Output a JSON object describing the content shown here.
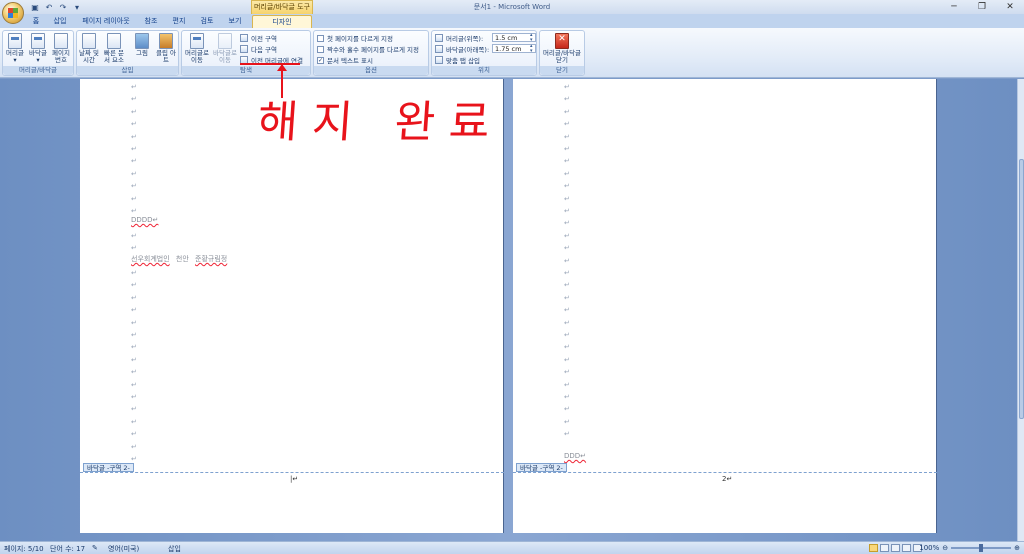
{
  "window": {
    "title": "문서1 - Microsoft Word",
    "context_tools": "머리글/바닥글 도구"
  },
  "qat": {
    "save_icon": "save-icon",
    "undo_icon": "undo-icon",
    "redo_icon": "redo-icon"
  },
  "tabs": [
    {
      "label": "홈"
    },
    {
      "label": "삽입"
    },
    {
      "label": "페이지 레이아웃"
    },
    {
      "label": "참조"
    },
    {
      "label": "편지"
    },
    {
      "label": "검토"
    },
    {
      "label": "보기"
    },
    {
      "label": "디자인"
    }
  ],
  "ribbon": {
    "header_footer": {
      "label": "머리글/바닥글",
      "header": "머리글",
      "footer": "바닥글",
      "page_number": "페이지 번호"
    },
    "insert": {
      "label": "삽입",
      "date_time": "날짜 및 시간",
      "quick_parts": "빠른 문서 요소",
      "picture": "그림",
      "clip_art": "클립 아트"
    },
    "navigation": {
      "label": "탐색",
      "goto_header": "머리글로 이동",
      "goto_footer": "바닥글로 이동",
      "prev_section": "이전 구역",
      "next_section": "다음 구역",
      "link_previous": "이전 머리글에 연결"
    },
    "options": {
      "label": "옵션",
      "different_first": "첫 페이지를 다르게 지정",
      "different_odd_even": "짝수와 홀수 페이지를 다르게 지정",
      "show_doc_text": "문서 텍스트 표시"
    },
    "position": {
      "label": "위치",
      "header_top_label": "머리글(위쪽):",
      "header_top_value": "1.5 cm",
      "footer_bottom_label": "바닥글(아래쪽):",
      "footer_bottom_value": "1.75 cm",
      "insert_align_tab": "맞춤 탭 삽입"
    },
    "close": {
      "label": "닫기",
      "close_button": "머리글/바닥글 닫기"
    }
  },
  "document": {
    "page1": {
      "line_dddd": "DDDD",
      "line_korean_1": "선우회계법인",
      "line_korean_2": "천안",
      "line_korean_3": "준황규림정",
      "footer_tag": "바닥글 -구역 2-"
    },
    "page2": {
      "line_ddd": "DDD",
      "footer_tag": "바닥글 -구역 2-",
      "footer_page_number": "2"
    },
    "para_mark": "↵"
  },
  "annotation": {
    "text": "해지 완료",
    "color": "#e8131b"
  },
  "status": {
    "page": "페이지: 5/10",
    "words": "단어 수: 17",
    "language": "영어(미국)",
    "mode": "삽입",
    "zoom": "100%"
  }
}
